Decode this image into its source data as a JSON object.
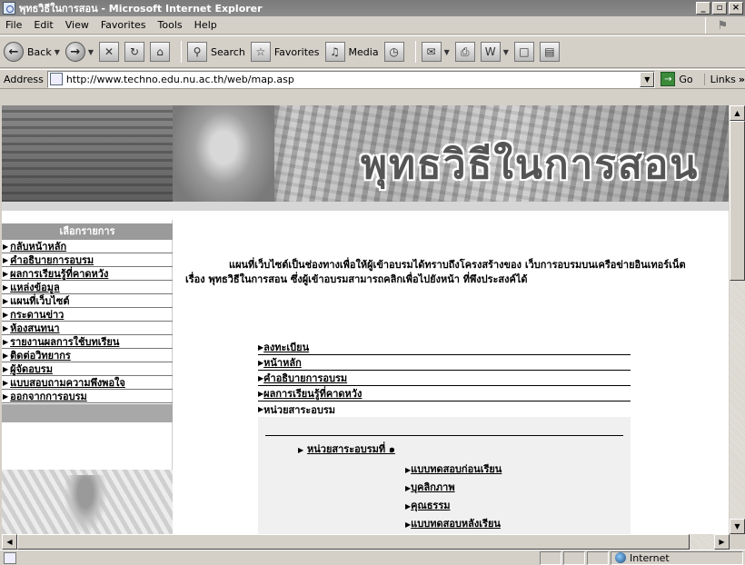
{
  "window": {
    "title": "พุทธวิธีในการสอน - Microsoft Internet Explorer",
    "controls": [
      "_",
      "▫",
      "×"
    ]
  },
  "menu": [
    "File",
    "Edit",
    "View",
    "Favorites",
    "Tools",
    "Help"
  ],
  "toolbar": {
    "back": "Back",
    "search": "Search",
    "favorites": "Favorites",
    "media": "Media"
  },
  "address": {
    "label": "Address",
    "url": "http://www.techno.edu.nu.ac.th/web/map.asp",
    "go": "Go",
    "links": "Links"
  },
  "banner": {
    "title": "พุทธวิธีในการสอน"
  },
  "sidebar": {
    "heading": "เลือกรายการ",
    "items": [
      {
        "label": "กลับหน้าหลัก",
        "link": true
      },
      {
        "label": "คำอธิบายการอบรม",
        "link": true
      },
      {
        "label": "ผลการเรียนรู้ที่คาดหวัง",
        "link": true
      },
      {
        "label": "แหล่งข้อมูล",
        "link": true
      },
      {
        "label": "แผนที่เว็บไซต์",
        "link": false
      },
      {
        "label": "กระดานข่าว",
        "link": true
      },
      {
        "label": "ห้องสนทนา",
        "link": true
      },
      {
        "label": "รายงานผลการใช้บทเรียน",
        "link": true
      },
      {
        "label": "ติดต่อวิทยากร",
        "link": true
      },
      {
        "label": "ผู้จัดอบรม",
        "link": true
      },
      {
        "label": "แบบสอบถามความพึงพอใจ",
        "link": true
      },
      {
        "label": "ออกจากการอบรม",
        "link": true
      }
    ]
  },
  "main": {
    "intro": "แผนที่เว็บไซต์เป็นช่องทางเพื่อให้ผู้เข้าอบรมได้ทราบถึงโครงสร้างของ เว็บการอบรมบนเครือข่ายอินเทอร์เน็ต เรื่อง พุทธวิธีในการสอน ซึ่งผู้เข้าอบรมสามารถคลิกเพื่อไปยังหน้า ที่พึงประสงค์ได้",
    "map_links": [
      {
        "label": "ลงทะเบียน",
        "link": true
      },
      {
        "label": "หน้าหลัก",
        "link": true
      },
      {
        "label": "คำอธิบายการอบรม",
        "link": true
      },
      {
        "label": "ผลการเรียนรู้ที่คาดหวัง",
        "link": true
      },
      {
        "label": "หน่วยสาระอบรม",
        "link": false
      }
    ],
    "unit": {
      "title": "หน่วยสาระอบรมที่ ๑",
      "subitems": [
        "แบบทดสอบก่อนเรียน",
        "บุคลิกภาพ",
        "คุณธรรม",
        "แบบทดสอบหลังเรียน"
      ]
    }
  },
  "status": {
    "zone": "Internet"
  }
}
